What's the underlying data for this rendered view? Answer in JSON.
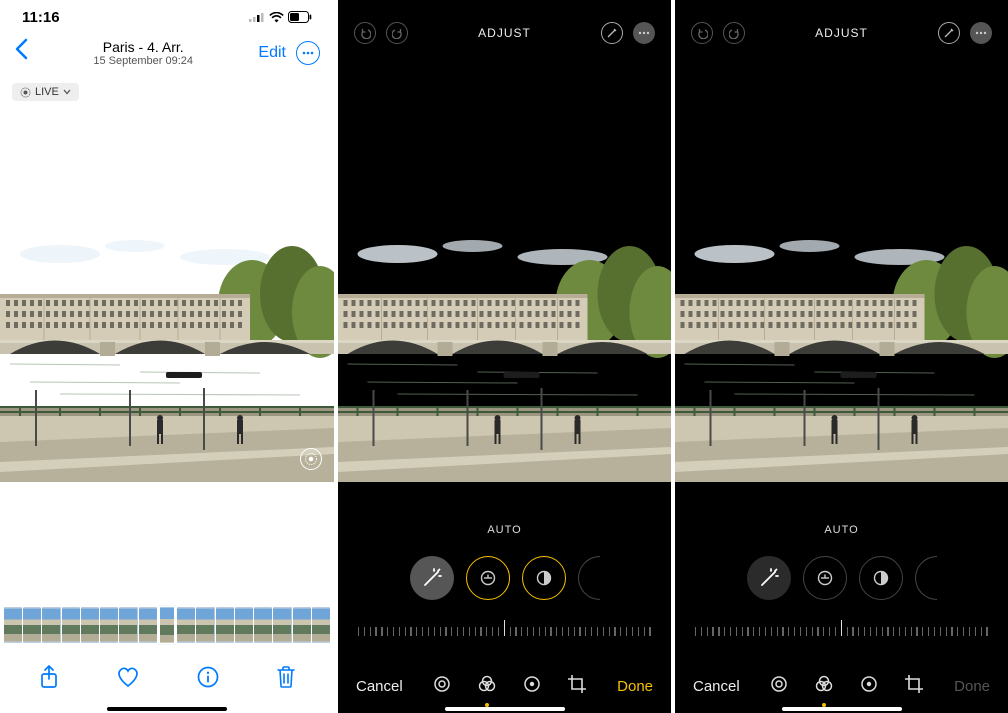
{
  "panel1": {
    "status_time": "11:16",
    "title": "Paris - 4. Arr.",
    "subtitle": "15 September  09:24",
    "edit_link": "Edit",
    "live_chip": "LIVE"
  },
  "panel2": {
    "header_label": "ADJUST",
    "mode_label": "AUTO",
    "cancel": "Cancel",
    "done": "Done"
  },
  "panel3": {
    "header_label": "ADJUST",
    "mode_label": "AUTO",
    "cancel": "Cancel",
    "done": "Done"
  },
  "scene": {
    "sky": "#5e9fd6",
    "sky_light": "#a9cde8",
    "cloud": "#e8f2f9",
    "buildings": "#d5ccb8",
    "building_shadow": "#b7ad96",
    "window": "#6e6b60",
    "bridge": "#c9c2af",
    "bridge_shadow": "#8d8877",
    "water": "#5c7a5f",
    "water_light": "#7a937a",
    "quay": "#b7b19b",
    "quay_shadow": "#8e8972",
    "rail": "#6a6a6a",
    "tree": "#6d8a3e",
    "tree_dark": "#4a6329",
    "person": "#2a2a2a"
  }
}
